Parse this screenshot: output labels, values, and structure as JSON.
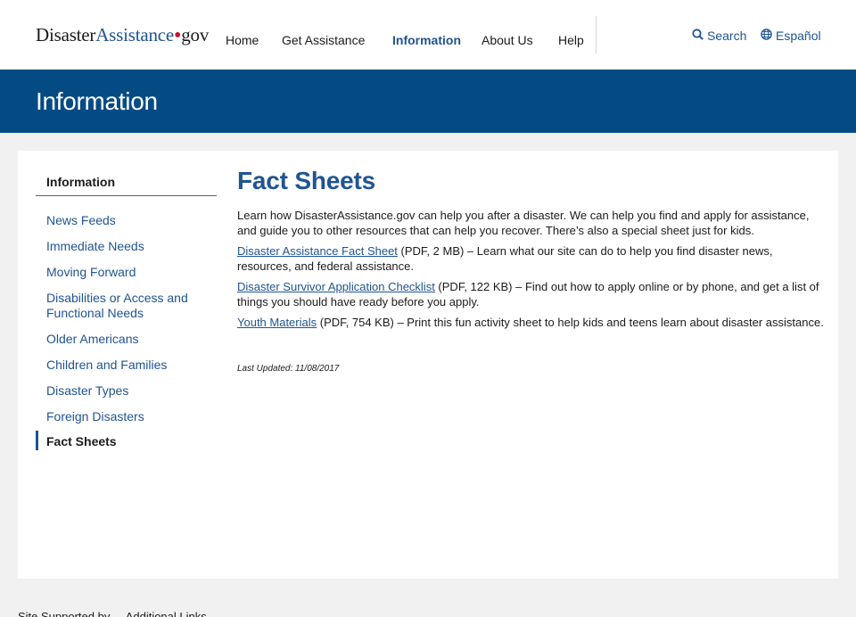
{
  "header": {
    "logo": {
      "part1": "Disaster",
      "part2": "Assistance",
      "dot": "•",
      "part3": "gov"
    },
    "nav": [
      {
        "label": "Home"
      },
      {
        "label": "Get Assistance"
      },
      {
        "label": "Information",
        "active": true
      },
      {
        "label": "About Us"
      },
      {
        "label": "Help"
      }
    ],
    "search_label": "Search",
    "language_label": "Español"
  },
  "banner": {
    "title": "Information"
  },
  "sidebar": {
    "title": "Information",
    "items": [
      {
        "label": "News Feeds"
      },
      {
        "label": "Immediate Needs"
      },
      {
        "label": "Moving Forward"
      },
      {
        "label": "Disabilities or Access and Functional Needs"
      },
      {
        "label": "Older Americans"
      },
      {
        "label": "Children and Families"
      },
      {
        "label": "Disaster Types"
      },
      {
        "label": "Foreign Disasters"
      },
      {
        "label": "Fact Sheets",
        "current": true
      }
    ]
  },
  "main": {
    "title": "Fact Sheets",
    "intro": "Learn how DisasterAssistance.gov can help you after a disaster. We can help you find and apply for assistance, and guide you to other resources that can help you recover. There’s also a special sheet just for kids.",
    "documents": [
      {
        "link": "Disaster Assistance Fact Sheet",
        "description": " (PDF, 2 MB) – Learn what our site can do to help you find disaster news, resources, and federal assistance."
      },
      {
        "link": "Disaster Survivor Application Checklist",
        "description": " (PDF, 122 KB) – Find out how to apply online or by phone, and get a list of things you should have ready before you apply."
      },
      {
        "link": "Youth Materials",
        "description": " (PDF, 754 KB) – Print this fun activity sheet to help kids and teens learn about disaster assistance."
      }
    ],
    "last_updated": "Last Updated: 11/08/2017"
  },
  "footer": {
    "partial_text": "Site Supported by ... Additional Links"
  },
  "colors": {
    "brand_blue": "#205493",
    "banner_blue": "#044b84",
    "logo_dot_red": "#c8102e",
    "page_bg": "#f1f1f1"
  },
  "icons": {
    "search": "search-icon",
    "language": "globe-icon"
  }
}
